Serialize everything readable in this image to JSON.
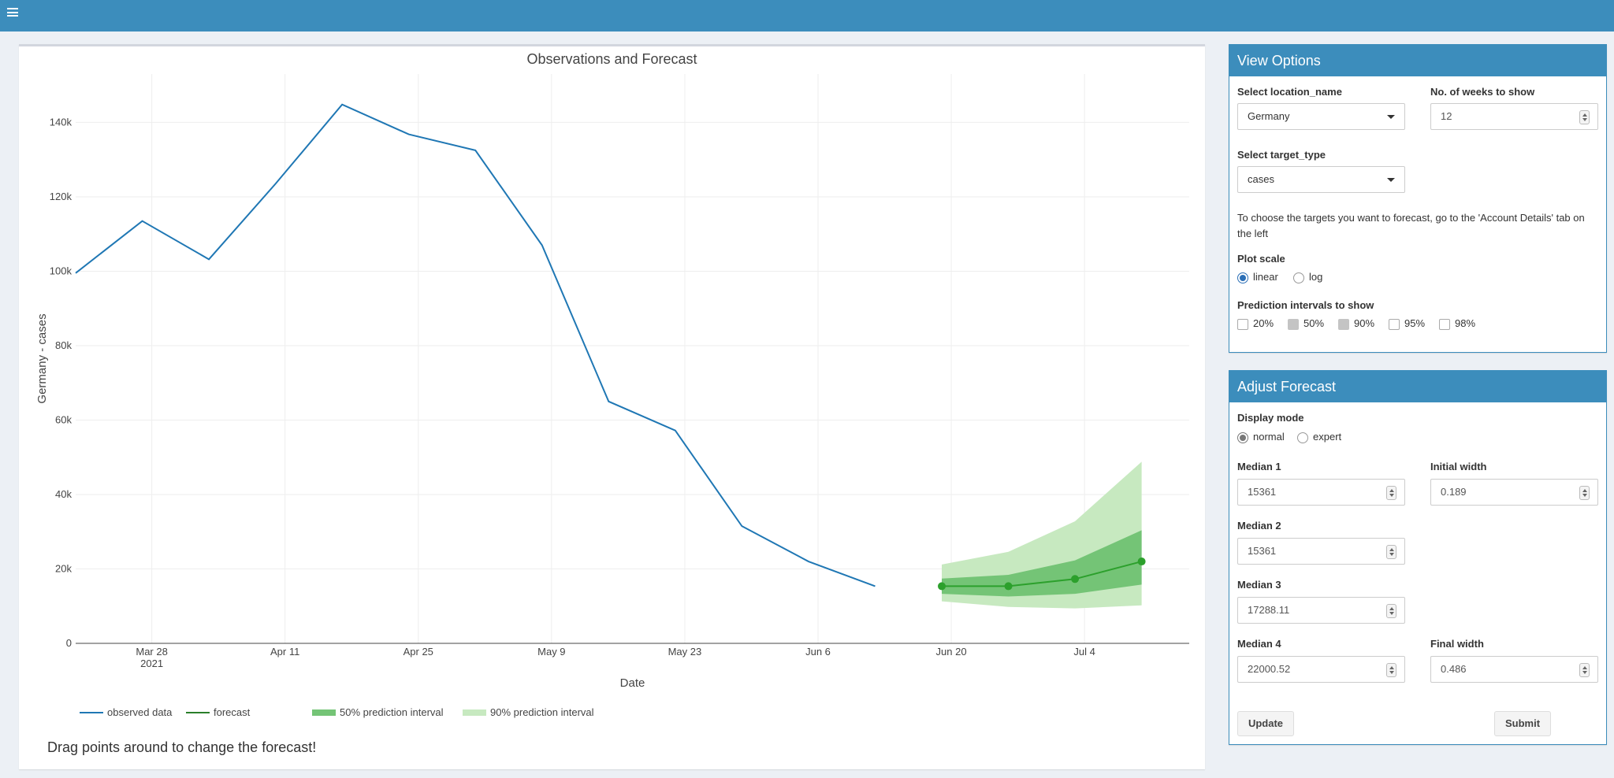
{
  "app": {
    "menu_icon": "hamburger-menu-icon",
    "accent_color": "#3c8dbc"
  },
  "plot": {
    "drag_hint": "Drag points around to change the forecast!",
    "legend": {
      "observed": "observed data",
      "forecast": "forecast",
      "pi50": "50% prediction interval",
      "pi90": "90% prediction interval"
    }
  },
  "chart_data": {
    "type": "line",
    "title": "Observations and Forecast",
    "xlabel": "Date",
    "ylabel": "Germany - cases",
    "x_ticks": [
      {
        "date": "2021-03-28",
        "label": "Mar 28",
        "sublabel": "2021"
      },
      {
        "date": "2021-04-11",
        "label": "Apr 11"
      },
      {
        "date": "2021-04-25",
        "label": "Apr 25"
      },
      {
        "date": "2021-05-09",
        "label": "May 9"
      },
      {
        "date": "2021-05-23",
        "label": "May 23"
      },
      {
        "date": "2021-06-06",
        "label": "Jun 6"
      },
      {
        "date": "2021-06-20",
        "label": "Jun 20"
      },
      {
        "date": "2021-07-04",
        "label": "Jul 4"
      }
    ],
    "y_ticks": [
      {
        "value": 0,
        "label": "0"
      },
      {
        "value": 20000,
        "label": "20k"
      },
      {
        "value": 40000,
        "label": "40k"
      },
      {
        "value": 60000,
        "label": "60k"
      },
      {
        "value": 80000,
        "label": "80k"
      },
      {
        "value": 100000,
        "label": "100k"
      },
      {
        "value": 120000,
        "label": "120k"
      },
      {
        "value": 140000,
        "label": "140k"
      }
    ],
    "xlim": [
      "2021-03-20",
      "2021-07-15"
    ],
    "ylim": [
      0,
      153000
    ],
    "grid": true,
    "legend_position": "bottom",
    "series": [
      {
        "name": "observed data",
        "color": "#1f77b4",
        "x": [
          "2021-03-20",
          "2021-03-27",
          "2021-04-03",
          "2021-04-10",
          "2021-04-17",
          "2021-04-24",
          "2021-05-01",
          "2021-05-08",
          "2021-05-15",
          "2021-05-22",
          "2021-05-29",
          "2021-06-05",
          "2021-06-12"
        ],
        "y": [
          99500,
          113500,
          103200,
          123500,
          144800,
          136800,
          132500,
          107000,
          65000,
          57200,
          31500,
          22000,
          15361
        ]
      },
      {
        "name": "forecast",
        "color": "#2ca02c",
        "x": [
          "2021-06-19",
          "2021-06-26",
          "2021-07-03",
          "2021-07-10"
        ],
        "y": [
          15361,
          15361,
          17288.11,
          22000.52
        ],
        "pi50_lower": [
          13300,
          12600,
          13300,
          15800
        ],
        "pi50_upper": [
          17400,
          18400,
          22300,
          30400
        ],
        "pi90_lower": [
          11300,
          9800,
          9400,
          10200
        ],
        "pi90_upper": [
          21200,
          24600,
          32800,
          48800
        ]
      }
    ]
  },
  "view_options": {
    "title": "View Options",
    "location_label": "Select location_name",
    "location_value": "Germany",
    "weeks_label": "No. of weeks to show",
    "weeks_value": "12",
    "target_label": "Select target_type",
    "target_value": "cases",
    "hint": "To choose the targets you want to forecast, go to the 'Account Details' tab on the left",
    "scale_label": "Plot scale",
    "scale_options": [
      "linear",
      "log"
    ],
    "scale_selected": "linear",
    "pi_label": "Prediction intervals to show",
    "pi_options": [
      "20%",
      "50%",
      "90%",
      "95%",
      "98%"
    ],
    "pi_checked": [
      "50%",
      "90%"
    ]
  },
  "adjust_forecast": {
    "title": "Adjust Forecast",
    "mode_label": "Display mode",
    "mode_options": [
      "normal",
      "expert"
    ],
    "mode_selected": "normal",
    "median1_label": "Median 1",
    "median1_value": "15361",
    "initial_width_label": "Initial width",
    "initial_width_value": "0.189",
    "median2_label": "Median 2",
    "median2_value": "15361",
    "median3_label": "Median 3",
    "median3_value": "17288.11",
    "median4_label": "Median 4",
    "median4_value": "22000.52",
    "final_width_label": "Final width",
    "final_width_value": "0.486",
    "update_label": "Update",
    "submit_label": "Submit"
  }
}
